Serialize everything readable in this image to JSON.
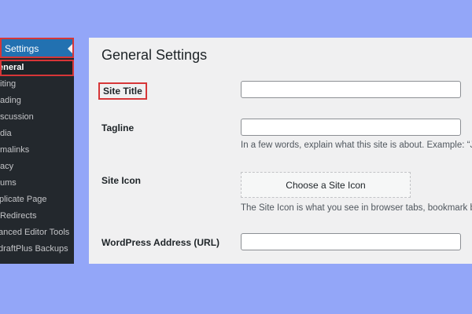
{
  "sidebar": {
    "header_label": "Settings",
    "items": [
      {
        "label": "eneral",
        "current": true
      },
      {
        "label": "iting"
      },
      {
        "label": "ading"
      },
      {
        "label": "scussion"
      },
      {
        "label": "dia"
      },
      {
        "label": "malinks"
      },
      {
        "label": "acy"
      },
      {
        "label": "ums"
      },
      {
        "label": "plicate Page"
      },
      {
        "label": "Redirects"
      },
      {
        "label": "anced Editor Tools"
      },
      {
        "label": "draftPlus Backups"
      }
    ]
  },
  "main": {
    "page_title": "General Settings",
    "fields": {
      "site_title": {
        "label": "Site Title",
        "value": ""
      },
      "tagline": {
        "label": "Tagline",
        "value": "",
        "description": "In a few words, explain what this site is about. Example: “J"
      },
      "site_icon": {
        "label": "Site Icon",
        "button_label": "Choose a Site Icon",
        "description": "The Site Icon is what you see in browser tabs, bookmark b"
      },
      "wordpress_address": {
        "label": "WordPress Address (URL)",
        "value": ""
      }
    }
  },
  "colors": {
    "background": "#93a6f8",
    "sidebar": "#23282d",
    "sidebar_active": "#2271b1",
    "highlight": "#d63638",
    "panel": "#f0f0f1"
  }
}
